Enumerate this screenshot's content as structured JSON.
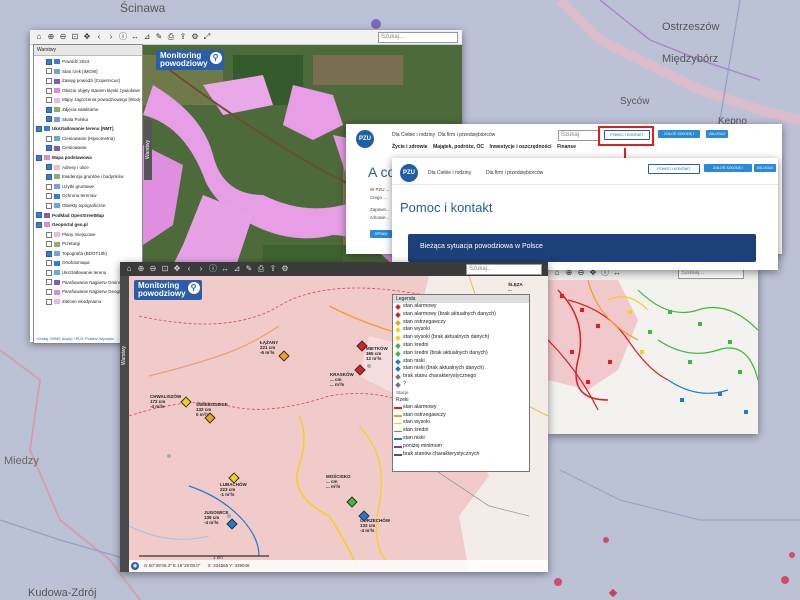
{
  "background_map": {
    "place_labels": [
      "Ścinawa",
      "Ostrzeszów",
      "Międzybórz",
      "Syców",
      "Kępno",
      "Kudowa-Zdrój",
      "Miedzy"
    ]
  },
  "top_window": {
    "search_placeholder": "Szukaj...",
    "logo": {
      "line1": "Monitoring",
      "line2": "powodziowy"
    },
    "side_tab": "Warstwy",
    "layers_panel": {
      "title": "Warstwy",
      "items": [
        {
          "label": "Powódź 2024",
          "checked": true,
          "bold": false
        },
        {
          "label": "Stan rzek [IMGW]",
          "checked": false,
          "bold": false
        },
        {
          "label": "Zasięg powodzi [Copernicus]",
          "checked": false,
          "bold": false
        },
        {
          "label": "Obszar objęty stanem klęski żywiołowej (Dz.U.2024,1365 i 1398)",
          "checked": false,
          "bold": false
        },
        {
          "label": "Mapy zagrożenia powodziowego [Wody Polskie]",
          "checked": false,
          "bold": false
        },
        {
          "label": "Zdjęcia satelitarne",
          "checked": true,
          "bold": false
        },
        {
          "label": "Skala Polska",
          "checked": true,
          "bold": false
        },
        {
          "label": "Ukształtowanie terenu [NMT]",
          "checked": true,
          "bold": true
        },
        {
          "label": "Cieniowanie (Hipsometria)",
          "checked": false,
          "bold": false
        },
        {
          "label": "Cieniowanie",
          "checked": true,
          "bold": false
        },
        {
          "label": "Mapa podstawowa",
          "checked": true,
          "bold": true
        },
        {
          "label": "Adresy i ulice",
          "checked": true,
          "bold": false
        },
        {
          "label": "Ewidencja gruntów i budynków",
          "checked": true,
          "bold": false
        },
        {
          "label": "Użytki gruntowe",
          "checked": false,
          "bold": false
        },
        {
          "label": "Ochrona terenów",
          "checked": false,
          "bold": false
        },
        {
          "label": "Obiekty topograficzne",
          "checked": false,
          "bold": false
        },
        {
          "label": "Podkład OpenStreetMap",
          "checked": true,
          "bold": true
        },
        {
          "label": "Geoportal geo.pl",
          "checked": true,
          "bold": true
        },
        {
          "label": "Plany miejscowe",
          "checked": false,
          "bold": false
        },
        {
          "label": "Przetargi",
          "checked": false,
          "bold": false
        },
        {
          "label": "Topografia (BDOT10k)",
          "checked": true,
          "bold": false
        },
        {
          "label": "Ortofotomapa",
          "checked": false,
          "bold": false
        },
        {
          "label": "Ukształtowanie terenu",
          "checked": false,
          "bold": false
        },
        {
          "label": "Parafiowanie Najpierw Gminne",
          "checked": false,
          "bold": false
        },
        {
          "label": "Parafiowanie Najpierw Geograficznych",
          "checked": false,
          "bold": false
        },
        {
          "label": "Zielone ekodynamo",
          "checked": false,
          "bold": false
        }
      ],
      "footer": "+Dodaj  +WMS (kopa)  +PLIK  Pobierz  Wyczyść"
    }
  },
  "pzu_back": {
    "logo": "PZU",
    "tabs": [
      "Dla Ciebie i rodziny",
      "Dla firm i przedsiębiorców"
    ],
    "search_placeholder": "Szukaj",
    "btn_help": "POMOC I KONTAKT",
    "btn_claim": "ZGŁOŚ SZKODĘ I ZGŁOSZENIA",
    "btn_login": "ZALOGUJ",
    "menu": [
      "Życie i zdrowie",
      "Majątek, podróże, OC",
      "Inwestycje i oszczędności",
      "Finanse"
    ],
    "heading_partial": "A co",
    "body_partial": [
      "W PZU ...",
      "czego ...",
      "Zapewn...",
      "zdrowie..."
    ],
    "button_partial": "SPRAW"
  },
  "pzu_front": {
    "logo": "PZU",
    "tabs": [
      "Dla Ciebie i rodziny",
      "Dla firm i przedsiębiorców"
    ],
    "btn_help": "POMOC I KONTAKT",
    "btn_claim": "ZGŁOŚ SZKODĘ I ZDARZENIA",
    "btn_login": "ZALOGUJ",
    "title": "Pomoc i kontakt",
    "banner": "Bieżąca sytuacja powodziowa w Polsce"
  },
  "right_map": {
    "search_placeholder": "Szukaj..."
  },
  "bottom_window": {
    "search_placeholder": "Szukaj...",
    "logo": {
      "line1": "Monitoring",
      "line2": "powodziowy"
    },
    "side_tab": "Warstwy",
    "legend": {
      "title": "Legenda",
      "items": [
        {
          "label": "stan alarmowy",
          "color": "#e01e1e"
        },
        {
          "label": "stan alarmowy (brak aktualnych danych)",
          "color": "#e01e1e"
        },
        {
          "label": "stan ostrzegawczy",
          "color": "#f0a020"
        },
        {
          "label": "stan wysoki",
          "color": "#f2d21a"
        },
        {
          "label": "stan wysoki (brak aktualnych danych)",
          "color": "#f2d21a"
        },
        {
          "label": "stan średni",
          "color": "#3cb83c"
        },
        {
          "label": "stan średni (brak aktualnych danych)",
          "color": "#3cb83c"
        },
        {
          "label": "stan niski",
          "color": "#1e7bd2"
        },
        {
          "label": "stan niski (brak aktualnych danych)",
          "color": "#1e7bd2"
        },
        {
          "label": "brak stanu charakterystycznego",
          "color": "#777777"
        },
        {
          "label": "?",
          "color": "#777777"
        }
      ],
      "section1": "Stacje",
      "section2": "Rzeki",
      "line_items": [
        {
          "label": "stan alarmowy",
          "color": "#e01e1e"
        },
        {
          "label": "stan ostrzegawczy",
          "color": "#f0a020"
        },
        {
          "label": "stan wysoki",
          "color": "#f2d21a"
        },
        {
          "label": "stan średni",
          "color": "#3cb83c"
        },
        {
          "label": "stan niski",
          "color": "#1e7bd2"
        },
        {
          "label": "poniżej minimum",
          "color": "#7a3cc0"
        },
        {
          "label": "brak stanów charakterystycznych",
          "color": "#555555"
        }
      ]
    },
    "towns": [
      {
        "name": "ŁĄŻANY",
        "value": "221 cm",
        "rate": "-6 m³/s"
      },
      {
        "name": "CHWALISZÓW",
        "value": "172 cm",
        "rate": "-4 m³/s"
      },
      {
        "name": "ŚWIEBODZICE",
        "value": "132 cm",
        "rate": "0 m³/s"
      },
      {
        "name": "KRASKÓW",
        "value": "... cm",
        "rate": "... m³/s"
      },
      {
        "name": "MIETKÓW",
        "value": "365 cm",
        "rate": "12 m³/s"
      },
      {
        "name": "LUBACHÓW",
        "value": "223 cm",
        "rate": "-1 m³/s"
      },
      {
        "name": "JUGOWICE",
        "value": "139 cm",
        "rate": "-4 m³/s"
      },
      {
        "name": "MOŚCISKO",
        "value": "... cm",
        "rate": "... m³/s"
      },
      {
        "name": "ODRZECHÓW",
        "value": "133 cm",
        "rate": "-4 m³/s"
      },
      {
        "name": "ŚLĘZA",
        "value": "...",
        "rate": "..."
      }
    ],
    "status_bar": {
      "scale": "1 km",
      "coords": "N 50°49'45.3\"  E 16°26'08.0\"",
      "lat_lon": "X: 334565  Y: 339046"
    }
  }
}
